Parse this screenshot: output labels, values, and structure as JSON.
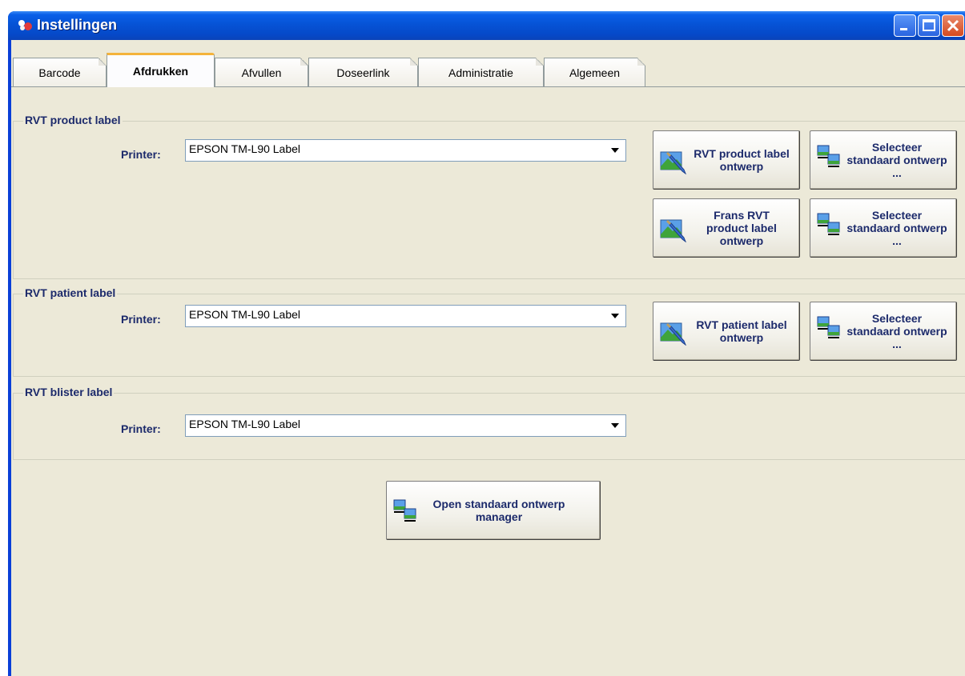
{
  "window": {
    "title": "Instellingen"
  },
  "tabs": [
    {
      "label": "Barcode",
      "active": false
    },
    {
      "label": "Afdrukken",
      "active": true
    },
    {
      "label": "Afvullen",
      "active": false
    },
    {
      "label": "Doseerlink",
      "active": false
    },
    {
      "label": "Administratie",
      "active": false
    },
    {
      "label": "Algemeen",
      "active": false
    }
  ],
  "product_group": {
    "title": "RVT product label",
    "printer_label": "Printer:",
    "printer_value": "EPSON TM-L90 Label",
    "design_button": "RVT product label ontwerp",
    "select_button_1": "Selecteer standaard ontwerp ...",
    "french_design_button": "Frans RVT product label ontwerp",
    "select_button_2": "Selecteer standaard ontwerp ..."
  },
  "patient_group": {
    "title": "RVT patient label",
    "printer_label": "Printer:",
    "printer_value": "EPSON TM-L90 Label",
    "design_button": "RVT patient label ontwerp",
    "select_button": "Selecteer standaard ontwerp ..."
  },
  "blister_group": {
    "title": "RVT blister label",
    "printer_label": "Printer:",
    "printer_value": "EPSON TM-L90 Label"
  },
  "manager_button": "Open standaard ontwerp manager",
  "colors": {
    "titlebar": "#0653d6",
    "client_bg": "#ece9d8",
    "label_text": "#1c2a6b",
    "active_tab_accent": "#f4b33b"
  },
  "icons": {
    "app": "app-logo-icon",
    "design": "paint-brush-icon",
    "select": "template-list-icon",
    "dropdown": "chevron-down-icon"
  }
}
